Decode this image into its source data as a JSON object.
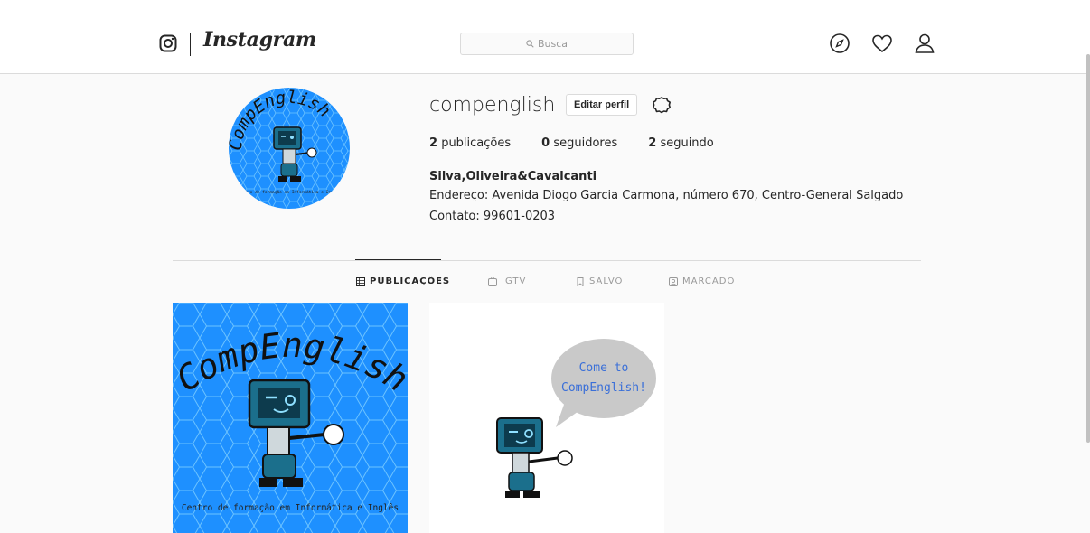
{
  "header": {
    "logo_text": "Instagram",
    "search_placeholder": "Busca",
    "icons": [
      "instagram-camera-icon",
      "compass-icon",
      "heart-icon",
      "user-icon",
      "search-icon"
    ]
  },
  "profile": {
    "username": "compenglish",
    "edit_button": "Editar perfil",
    "avatar_text": "CompEnglish",
    "avatar_subtext": "Centro de formação em Informática e Inglês",
    "stats": [
      {
        "count": "2",
        "label": "publicações"
      },
      {
        "count": "0",
        "label": "seguidores"
      },
      {
        "count": "2",
        "label": "seguindo"
      }
    ],
    "bio_name": "Silva,Oliveira&Cavalcanti",
    "bio_lines": [
      "Endereço: Avenida Diogo Garcia Carmona, número 670, Centro-General Salgado",
      "Contato: 99601-0203"
    ]
  },
  "tabs": [
    {
      "label": "PUBLICAÇÕES",
      "icon": "grid-icon",
      "active": true
    },
    {
      "label": "IGTV",
      "icon": "tv-icon",
      "active": false
    },
    {
      "label": "SALVO",
      "icon": "bookmark-icon",
      "active": false
    },
    {
      "label": "MARCADO",
      "icon": "tag-icon",
      "active": false
    }
  ],
  "posts": [
    {
      "title": "CompEnglish",
      "caption": "Centro de formação em Informática e Inglês",
      "bg": "#1e90ff"
    },
    {
      "speech_line1": "Come to",
      "speech_line2": "CompEnglish!",
      "bg": "#ffffff"
    }
  ],
  "colors": {
    "accent": "#262626",
    "border": "#dbdbdb",
    "post_blue": "#1e90ff",
    "robot_teal": "#1b6f8c"
  }
}
